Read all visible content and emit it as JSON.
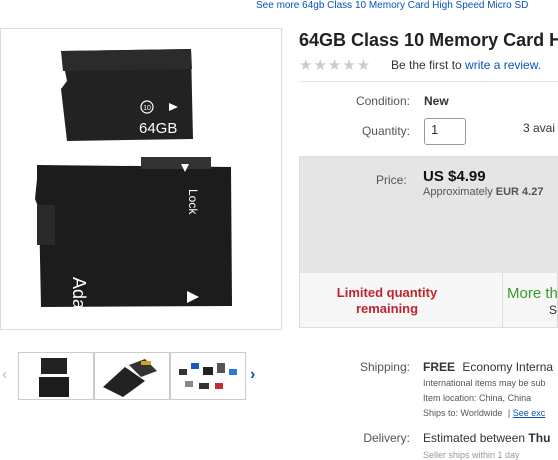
{
  "top_link": "See more 64gb Class 10 Memory Card High Speed Micro SD",
  "product": {
    "title": "64GB Class 10 Memory Card H",
    "stars": "★★★★★",
    "review_prefix": "Be the first to",
    "review_link": "write a review.",
    "card_label": "64GB",
    "card_class": "10",
    "adapter_label": "Adapter",
    "lock_label": "Lock"
  },
  "condition": {
    "label": "Condition:",
    "value": "New"
  },
  "quantity": {
    "label": "Quantity:",
    "value": "1",
    "available": "3 avai"
  },
  "price": {
    "label": "Price:",
    "value": "US $4.99",
    "approx_prefix": "Approximately",
    "approx_value": "EUR 4.27",
    "limited": "Limited quantity remaining",
    "more": "More th",
    "more_sub": "S"
  },
  "shipping": {
    "label": "Shipping:",
    "free": "FREE",
    "method": "Economy Interna",
    "note": "International items may be sub",
    "location_label": "Item location:",
    "location": "China, China",
    "ships_label": "Ships to:",
    "ships": "Worldwide",
    "see_link": "See exc"
  },
  "delivery": {
    "label": "Delivery:",
    "value_prefix": "Estimated between",
    "value_bold": "Thu",
    "sub": "Seller ships within 1 day"
  },
  "nav": {
    "prev": "‹",
    "next": "›"
  },
  "colors": {
    "link": "#0654ba",
    "limited": "#c0242f",
    "more": "#359b29"
  }
}
